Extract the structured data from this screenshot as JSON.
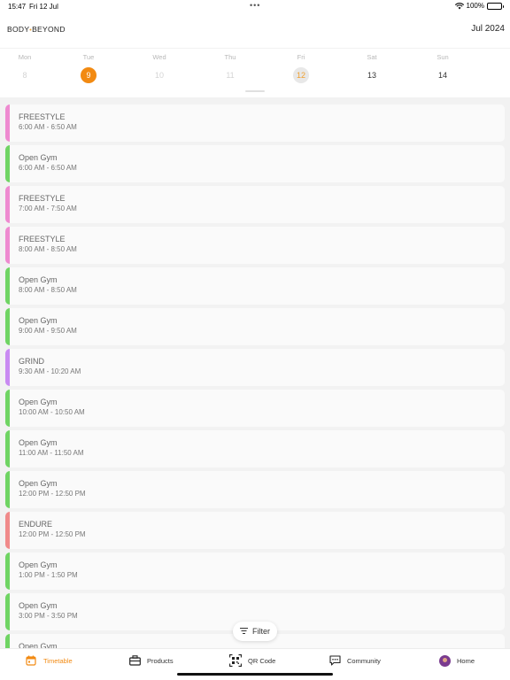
{
  "status": {
    "time": "15:47",
    "date": "Fri 12 Jul",
    "battery": "100%"
  },
  "header": {
    "logo_left": "BODY",
    "logo_right": "BEYOND",
    "month": "Jul 2024"
  },
  "week": [
    {
      "name": "Mon",
      "num": "8",
      "state": "past"
    },
    {
      "name": "Tue",
      "num": "9",
      "state": "selected"
    },
    {
      "name": "Wed",
      "num": "10",
      "state": "past"
    },
    {
      "name": "Thu",
      "num": "11",
      "state": "past"
    },
    {
      "name": "Fri",
      "num": "12",
      "state": "today"
    },
    {
      "name": "Sat",
      "num": "13",
      "state": "active"
    },
    {
      "name": "Sun",
      "num": "14",
      "state": "active"
    }
  ],
  "classes": [
    {
      "title": "FREESTYLE",
      "time": "6:00 AM - 6:50 AM",
      "color": "#ee8ad0"
    },
    {
      "title": "Open Gym",
      "time": "6:00 AM - 6:50 AM",
      "color": "#6fd463"
    },
    {
      "title": "FREESTYLE",
      "time": "7:00 AM - 7:50 AM",
      "color": "#ee8ad0"
    },
    {
      "title": "FREESTYLE",
      "time": "8:00 AM - 8:50 AM",
      "color": "#ee8ad0"
    },
    {
      "title": "Open Gym",
      "time": "8:00 AM - 8:50 AM",
      "color": "#6fd463"
    },
    {
      "title": "Open Gym",
      "time": "9:00 AM - 9:50 AM",
      "color": "#6fd463"
    },
    {
      "title": "GRIND",
      "time": "9:30 AM - 10:20 AM",
      "color": "#c98af2"
    },
    {
      "title": "Open Gym",
      "time": "10:00 AM - 10:50 AM",
      "color": "#6fd463"
    },
    {
      "title": "Open Gym",
      "time": "11:00 AM - 11:50 AM",
      "color": "#6fd463"
    },
    {
      "title": "Open Gym",
      "time": "12:00 PM - 12:50 PM",
      "color": "#6fd463"
    },
    {
      "title": "ENDURE",
      "time": "12:00 PM - 12:50 PM",
      "color": "#f08a8a"
    },
    {
      "title": "Open Gym",
      "time": "1:00 PM - 1:50 PM",
      "color": "#6fd463"
    },
    {
      "title": "Open Gym",
      "time": "3:00 PM - 3:50 PM",
      "color": "#6fd463"
    },
    {
      "title": "Open Gym",
      "time": "",
      "color": "#6fd463"
    }
  ],
  "filter": {
    "label": "Filter",
    "icon": "filter-icon"
  },
  "tabs": [
    {
      "label": "Timetable",
      "icon": "calendar-icon",
      "active": true
    },
    {
      "label": "Products",
      "icon": "briefcase-icon",
      "active": false
    },
    {
      "label": "QR Code",
      "icon": "qr-code-icon",
      "active": false
    },
    {
      "label": "Community",
      "icon": "chat-icon",
      "active": false
    },
    {
      "label": "Home",
      "icon": "avatar",
      "active": false
    }
  ],
  "colors": {
    "accent": "#f28a12",
    "freestyle": "#ee8ad0",
    "open_gym": "#6fd463",
    "grind": "#c98af2",
    "endure": "#f08a8a"
  }
}
